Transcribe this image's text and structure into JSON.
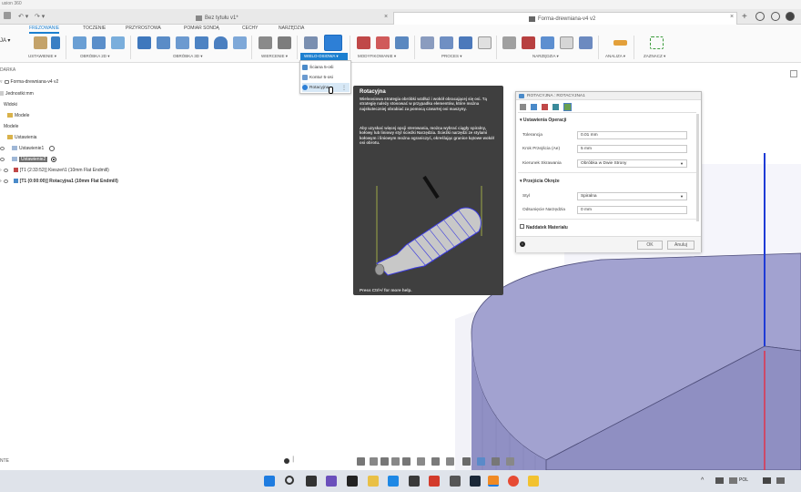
{
  "app": {
    "title": "usion 360"
  },
  "doc_tabs": [
    {
      "label": "Bez tytułu v1*"
    },
    {
      "label": "Forma-drewniana-v4 v2"
    }
  ],
  "ribbon": {
    "tabs": [
      "FREZOWANIE",
      "TOCZENIE",
      "PRZYROSTOWA",
      "POMIAR SONDĄ",
      "CECHY",
      "NARZĘDZIA"
    ],
    "active_tab": "FREZOWANIE",
    "groups": [
      "USTAWIENIE ▾",
      "OBRÓBKA 2D ▾",
      "OBRÓBKA 3D ▾",
      "WIERCENIE ▾",
      "WIELO-OSIOWA ▾",
      "MODYFIKOWANIE ▾",
      "PROCES ▾",
      "NARZĘDZIA ▾",
      "ANALIZA ▾",
      "ZAZNACZ ▾"
    ],
    "partial_left": "JA ▾",
    "active_group": "WIELO-OSIOWA ▾"
  },
  "dropdown": {
    "items": [
      "Ściana 5-ośi",
      "Kontur 5-osi",
      "Rotacyjna"
    ],
    "hover_item": "Rotacyjna"
  },
  "browser": {
    "header": "DARKA",
    "rows": [
      {
        "label": "Forma-drewniana-v4 v2"
      },
      {
        "label": "Jednostki:mm"
      },
      {
        "label": "Widoki"
      },
      {
        "label": "Modele"
      },
      {
        "label": "Modele"
      },
      {
        "label": "Ustawienia"
      },
      {
        "label": "Ustawienie1"
      },
      {
        "label": "Ustawienie2"
      },
      {
        "label": "[T1 (2:33:52)] Kieszeń1 (10mm Flat Endmill)"
      },
      {
        "label": "[T1 (0:00:00)] Rotacyjna1 (10mm Flat Endmill)"
      }
    ],
    "footer": "NTE"
  },
  "tooltip": {
    "title": "Rotacyjna",
    "p1": "Wieloosiowa strategia obróbki wzdłuż i wokół obracającej się osi. Tą strategię należy stosować w przypadku elementów, które można najskuteczniej obrabiać za pomocą czwartej osi maszyny.",
    "p2": "Aby uzyskać więcej opcji sterowania, można wybrać ciągły spiralny, kołowy lub liniowy styl ścieżki Narzędzia. Ścieżki narzędzi ze stylami kołowym i liniowym można ograniczyć, określając granice kątowe wokół osi obrotu.",
    "footer": "Press Ctrl+/ for more help."
  },
  "dialog": {
    "title": "ROTACYJNA : ROTACYJNA1",
    "section1": "Ustawienia Operacji",
    "fields1": [
      {
        "label": "Tolerancja",
        "value": "0.01 mm"
      },
      {
        "label": "Krok Przejścia (Ae)",
        "value": "5 mm"
      },
      {
        "label": "Kierunek Skrawania",
        "value": "Obróbka w Dwie Strony"
      }
    ],
    "section2": "Przejścia Okręże",
    "fields2": [
      {
        "label": "Styl",
        "value": "Spiralna"
      },
      {
        "label": "Odsunięcie Narzędzia",
        "value": "0 mm"
      }
    ],
    "section3": "Naddatek Materiału",
    "ok": "OK",
    "cancel": "Anuluj"
  },
  "taskbar": {
    "lang": "POL"
  },
  "colors": {
    "accent": "#1b7fd0",
    "model_face": "#9a9ac8",
    "model_top": "#8c8cbf",
    "axis_blue": "#1e3bd6",
    "axis_red": "#e0344b"
  }
}
